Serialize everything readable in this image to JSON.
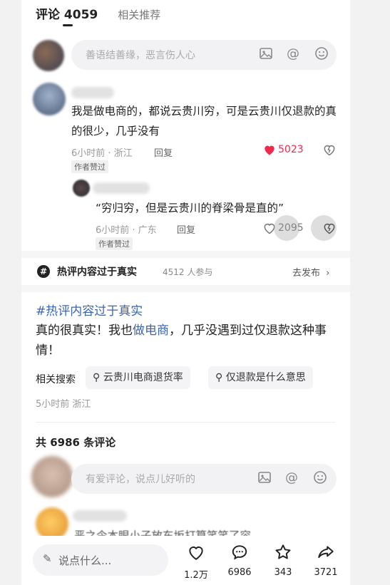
{
  "tabs": {
    "comments": "评论 4059",
    "related": "相关推荐"
  },
  "top_input": {
    "placeholder": "善语结善缘，恶言伤人心"
  },
  "comment1": {
    "text": "我是做电商的，都说云贵川穷，可是云贵川仅退款的真的很少，几乎没有",
    "meta": "6小时前 · 浙江",
    "reply_label": "回复",
    "likes": "5023",
    "badge": "作者赞过"
  },
  "reply1": {
    "text": "“穷归穷，但是云贵川的脊梁骨是直的”",
    "meta": "6小时前 · 广东",
    "reply_label": "回复",
    "likes": "2095",
    "badge": "作者赞过"
  },
  "topic": {
    "icon": "#",
    "title": "热评内容过于真实",
    "count": "4512 人参与",
    "go": "去发布"
  },
  "post": {
    "hashtag": "#热评内容过于真实",
    "body_pre": "真的很真实！我也",
    "body_link": "做电商",
    "body_post": "，几乎没遇到过仅退款这种事情！",
    "search_label": "相关搜索",
    "chips": [
      "云贵川电商退货率",
      "仅退款是什么意思"
    ],
    "meta": "5小时前  浙江"
  },
  "total": "共 6986 条评论",
  "second_input": {
    "placeholder": "有爱评论，说点儿好听的"
  },
  "partial_text": "恶之令本眼小子放东坂打算笑笑了容",
  "bottom": {
    "say": "说点什么...",
    "like": "1.2万",
    "comment": "6986",
    "star": "343",
    "share": "3721"
  }
}
